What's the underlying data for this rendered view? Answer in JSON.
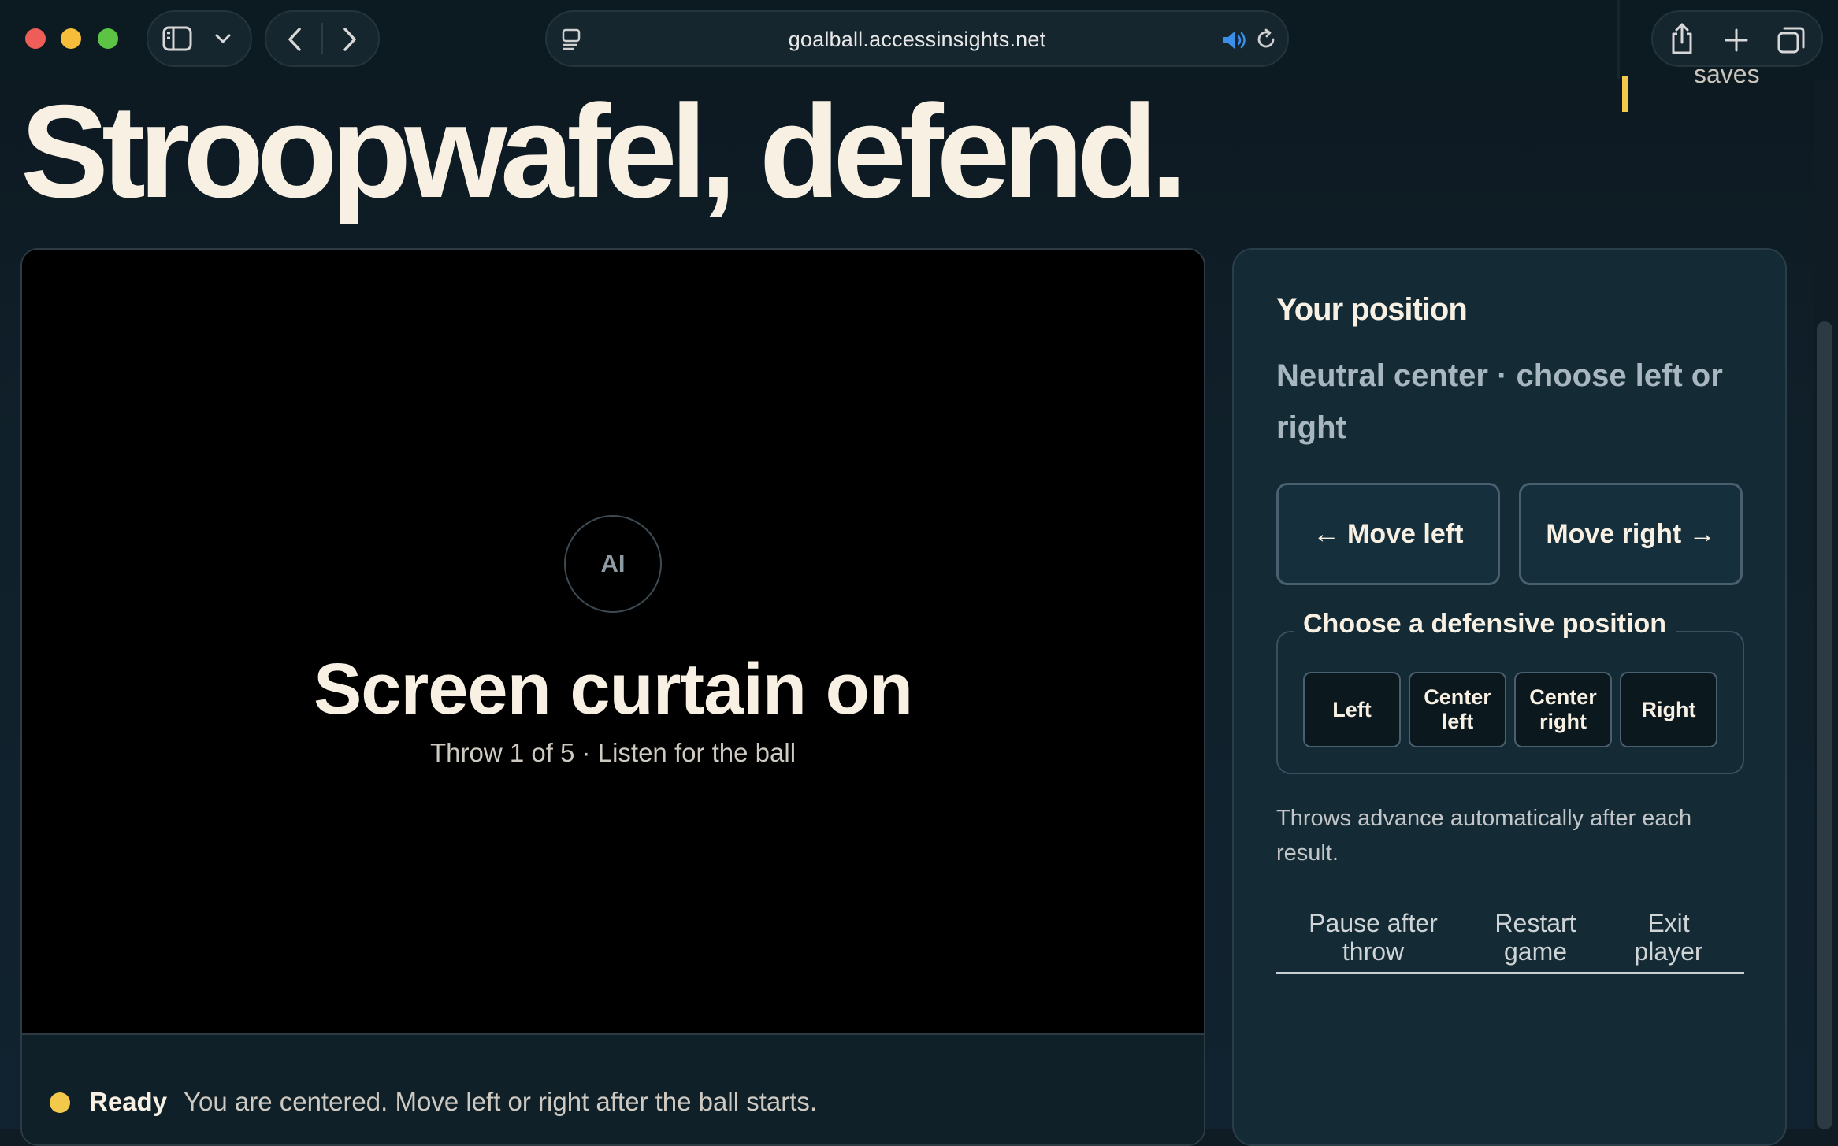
{
  "browser": {
    "url": "goalball.accessinsights.net",
    "icons": {
      "sidebar": "sidebar-icon",
      "tab_overview": "chevron-down-icon",
      "back": "back-icon",
      "forward": "forward-icon",
      "page_menu": "page-menu-icon",
      "audio": "speaker-icon",
      "reload": "reload-icon",
      "share": "share-icon",
      "new_tab": "plus-icon",
      "tabs": "tabs-icon"
    }
  },
  "header": {
    "saves_label": "saves",
    "title": "Stroopwafel, defend."
  },
  "stage": {
    "badge": "AI",
    "title": "Screen curtain on",
    "subtitle": "Throw 1 of 5 · Listen for the ball",
    "status_label": "Ready",
    "status_text": "You are centered. Move left or right after the ball starts."
  },
  "panel": {
    "heading": "Your position",
    "position": "Neutral center · choose left or right",
    "move_left": "← Move left",
    "move_right": "Move right →",
    "fieldset_legend": "Choose a defensive position",
    "positions": [
      "Left",
      "Center left",
      "Center right",
      "Right"
    ],
    "auto_note": "Throws advance automatically after each result.",
    "links": {
      "pause": "Pause after throw",
      "restart": "Restart game",
      "exit": "Exit player"
    }
  },
  "colors": {
    "accent": "#f3c94b",
    "background": "#0f1c24",
    "panel": "#142a35",
    "text": "#f7f0e3"
  }
}
